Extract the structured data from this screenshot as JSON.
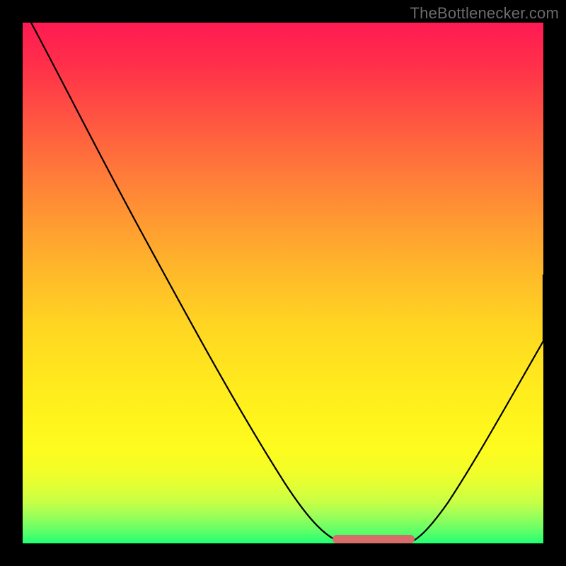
{
  "watermark": {
    "text": "TheBottlenecker.com"
  },
  "colors": {
    "background": "#000000",
    "curve": "#000000",
    "highlight": "#d76d69",
    "gradient_top": "#ff1a53",
    "gradient_bottom": "#20ff72"
  },
  "chart_data": {
    "type": "line",
    "title": "",
    "xlabel": "",
    "ylabel": "",
    "xlim": [
      0,
      100
    ],
    "ylim": [
      0,
      100
    ],
    "grid": false,
    "legend": false,
    "series": [
      {
        "name": "left-curve",
        "x": [
          2,
          10,
          20,
          30,
          40,
          50,
          57,
          61,
          63
        ],
        "y": [
          100,
          86,
          68,
          51,
          34,
          17,
          5,
          1,
          0
        ]
      },
      {
        "name": "right-curve",
        "x": [
          74,
          76,
          80,
          85,
          90,
          95,
          100
        ],
        "y": [
          0,
          1,
          7,
          17,
          28,
          40,
          52
        ]
      }
    ],
    "highlight_range": {
      "x_start": 60,
      "x_end": 75,
      "y": 0
    }
  }
}
